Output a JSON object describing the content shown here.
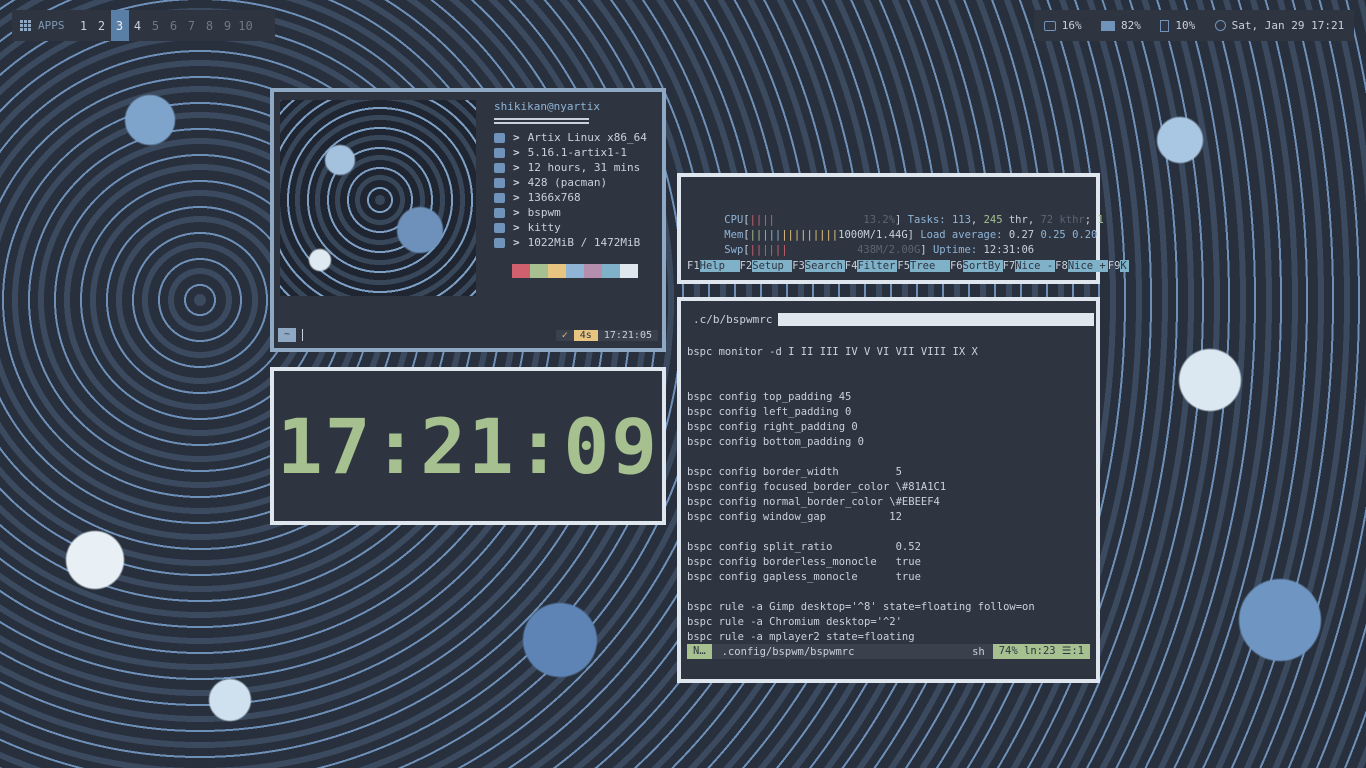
{
  "topbar": {
    "apps_label": "APPS",
    "workspaces": [
      "1",
      "2",
      "3",
      "4",
      "5",
      "6",
      "7",
      "8",
      "9",
      "10"
    ],
    "active_workspace": "3",
    "status": {
      "disk": "16%",
      "memory": "82%",
      "cpu": "10%",
      "datetime": "Sat, Jan 29 17:21"
    }
  },
  "fetch": {
    "user_host": "shikikan@nyartix",
    "rows": [
      {
        "icon": "user-icon",
        "value": "Artix Linux x86_64"
      },
      {
        "icon": "gear-icon",
        "value": "5.16.1-artix1-1"
      },
      {
        "icon": "clock-icon",
        "value": "12 hours, 31 mins"
      },
      {
        "icon": "cart-icon",
        "value": "428 (pacman)"
      },
      {
        "icon": "image-icon",
        "value": "1366x768"
      },
      {
        "icon": "window-icon",
        "value": "bspwm"
      },
      {
        "icon": "terminal-icon",
        "value": "kitty"
      },
      {
        "icon": "memory-icon",
        "value": "1022MiB / 1472MiB"
      }
    ],
    "palette": [
      "#2e3541",
      "#d0606e",
      "#a6c08f",
      "#e7c47f",
      "#8fb4d6",
      "#b48ead",
      "#7fb2c8",
      "#dfe6ee"
    ],
    "prompt": {
      "dir": "~",
      "check": "✓",
      "duration": "4s",
      "time": "17:21:05"
    }
  },
  "clock": {
    "time": "17:21:09"
  },
  "htop": {
    "cpu_label": "CPU",
    "cpu_value": "13.2%",
    "mem_label": "Mem",
    "mem_value": "1000M/1.44G",
    "swp_label": "Swp",
    "swp_value": "438M/2.00G",
    "tasks_label": "Tasks:",
    "tasks": "113",
    "thr": "245",
    "kthr": "72",
    "running": "1",
    "load_label": "Load average:",
    "load": [
      "0.27",
      "0.25",
      "0.20"
    ],
    "uptime_label": "Uptime:",
    "uptime": "12:31:06",
    "keys": [
      {
        "k": "F1",
        "l": "Help  "
      },
      {
        "k": "F2",
        "l": "Setup "
      },
      {
        "k": "F3",
        "l": "Search"
      },
      {
        "k": "F4",
        "l": "Filter"
      },
      {
        "k": "F5",
        "l": "Tree  "
      },
      {
        "k": "F6",
        "l": "SortBy"
      },
      {
        "k": "F7",
        "l": "Nice -"
      },
      {
        "k": "F8",
        "l": "Nice +"
      },
      {
        "k": "F9",
        "l": "K"
      }
    ]
  },
  "editor": {
    "tab_name": ".c/b/bspwmrc",
    "lines": [
      "bspc monitor -d I II III IV V VI VII VIII IX X",
      "",
      "",
      "bspc config top_padding 45",
      "bspc config left_padding 0",
      "bspc config right_padding 0",
      "bspc config bottom_padding 0",
      "",
      "bspc config border_width         5",
      "bspc config focused_border_color \\#81A1C1",
      "bspc config normal_border_color \\#EBEEF4",
      "bspc config window_gap          12",
      "",
      "bspc config split_ratio          0.52",
      "bspc config borderless_monocle   true",
      "bspc config gapless_monocle      true",
      "",
      "bspc rule -a Gimp desktop='^8' state=floating follow=on",
      "bspc rule -a Chromium desktop='^2'",
      "bspc rule -a mplayer2 state=floating"
    ],
    "status": {
      "mode": "N…",
      "path": ".config/bspwm/bspwmrc",
      "filetype": "sh",
      "position": "74% ln:23 ☰:1"
    }
  }
}
